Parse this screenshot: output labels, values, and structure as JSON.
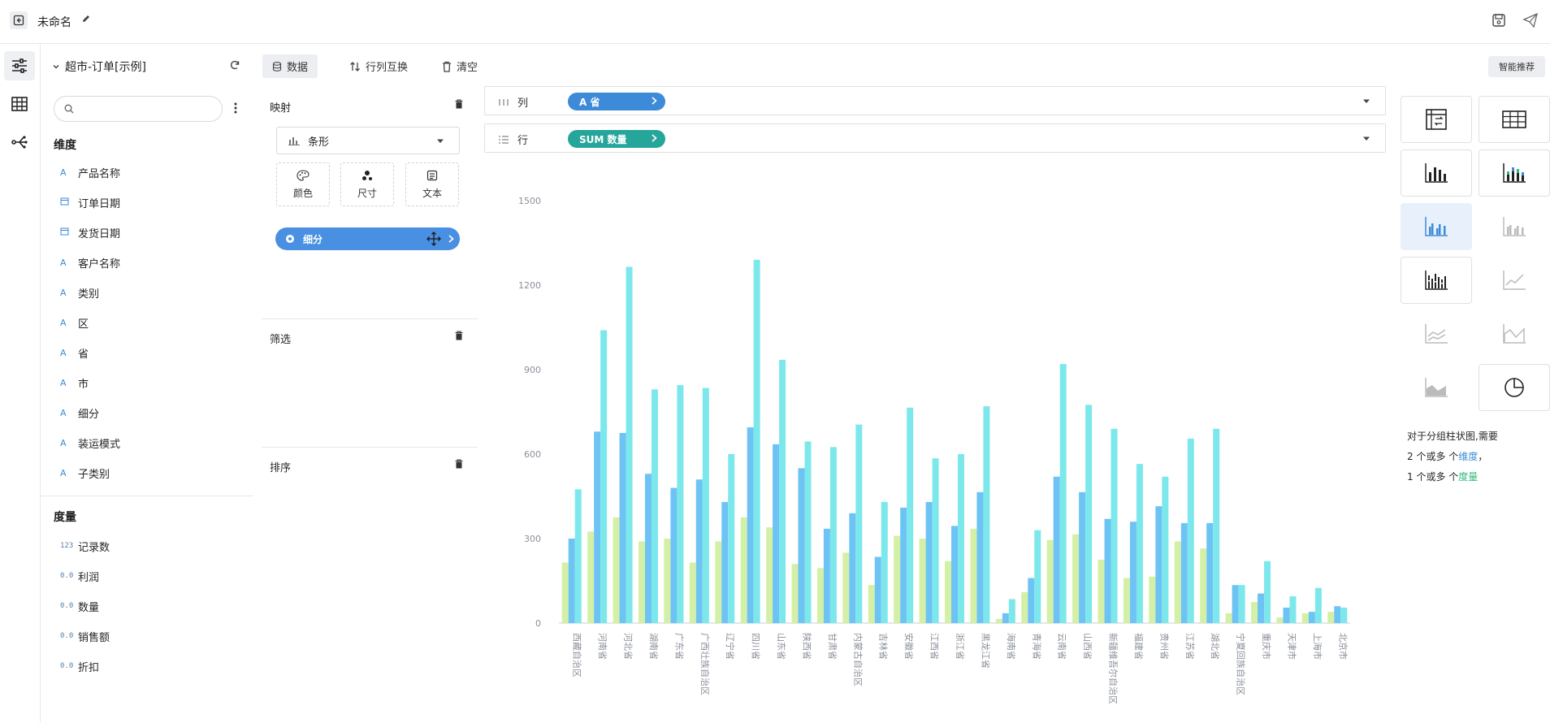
{
  "header": {
    "title": "未命名"
  },
  "dataset": {
    "name": "超市-订单[示例]"
  },
  "search": {
    "placeholder": ""
  },
  "fields": {
    "dimension_header": "维度",
    "dimensions": [
      {
        "type": "date-icon",
        "label": "产品名称",
        "t": "A"
      },
      {
        "type": "calendar-icon",
        "label": "订单日期",
        "t": "cal"
      },
      {
        "type": "calendar-icon",
        "label": "发货日期",
        "t": "cal"
      },
      {
        "type": "text",
        "label": "客户名称",
        "t": "A"
      },
      {
        "type": "text",
        "label": "类别",
        "t": "A"
      },
      {
        "type": "text",
        "label": "区",
        "t": "A"
      },
      {
        "type": "text",
        "label": "省",
        "t": "A"
      },
      {
        "type": "text",
        "label": "市",
        "t": "A"
      },
      {
        "type": "text",
        "label": "细分",
        "t": "A"
      },
      {
        "type": "text",
        "label": "装运模式",
        "t": "A"
      },
      {
        "type": "text",
        "label": "子类别",
        "t": "A"
      }
    ],
    "measure_header": "度量",
    "measures": [
      {
        "label": "记录数",
        "t": "123"
      },
      {
        "label": "利润",
        "t": "0.0"
      },
      {
        "label": "数量",
        "t": "0.0"
      },
      {
        "label": "销售额",
        "t": "0.0"
      },
      {
        "label": "折扣",
        "t": "0.0"
      }
    ]
  },
  "toolbar": {
    "data_label": "数据",
    "swap_label": "行列互换",
    "clear_label": "清空",
    "smart_label": "智能推荐"
  },
  "marks": {
    "mapping_label": "映射",
    "mark_type": "条形",
    "color_label": "颜色",
    "size_label": "尺寸",
    "text_label": "文本",
    "detail_pill": "细分",
    "filter_label": "筛选",
    "sort_label": "排序"
  },
  "shelves": {
    "columns_label": "列",
    "columns_pill": "A 省",
    "rows_label": "行",
    "rows_pill": "SUM  数量"
  },
  "colors": {
    "series1": "#d4f0a6",
    "series2": "#6ec3f5",
    "series3": "#7de8ec",
    "accent": "#4a90e2",
    "teal": "#26a69a"
  },
  "hint": {
    "line1": "对于分组柱状图,需要",
    "line2_prefix": "2 个或多 个",
    "line2_highlight": "维度",
    "line2_suffix": "，",
    "line3_prefix": "1 个或多 个",
    "line3_highlight": "度量"
  },
  "chart_data": {
    "type": "bar",
    "ylim": [
      0,
      1500
    ],
    "yticks": [
      0,
      300,
      600,
      900,
      1200,
      1500
    ],
    "categories": [
      "西藏自治区",
      "河南省",
      "河北省",
      "湖南省",
      "广东省",
      "广西壮族自治区",
      "辽宁省",
      "四川省",
      "山东省",
      "陕西省",
      "甘肃省",
      "内蒙古自治区",
      "吉林省",
      "安徽省",
      "江西省",
      "浙江省",
      "黑龙江省",
      "海南省",
      "青海省",
      "云南省",
      "山西省",
      "新疆维吾尔自治区",
      "福建省",
      "贵州省",
      "江苏省",
      "湖北省",
      "宁夏回族自治区",
      "重庆市",
      "天津市",
      "上海市",
      "北京市"
    ],
    "series": [
      {
        "values": [
          215,
          325,
          375,
          290,
          300,
          215,
          290,
          375,
          340,
          210,
          195,
          250,
          135,
          310,
          300,
          220,
          335,
          15,
          110,
          295,
          315,
          225,
          160,
          165,
          290,
          265,
          35,
          75,
          20,
          35,
          40
        ]
      },
      {
        "values": [
          300,
          680,
          675,
          530,
          480,
          510,
          430,
          695,
          635,
          550,
          335,
          390,
          235,
          410,
          430,
          345,
          465,
          35,
          160,
          520,
          465,
          370,
          360,
          415,
          355,
          355,
          135,
          105,
          55,
          40,
          60
        ]
      },
      {
        "values": [
          475,
          1040,
          1265,
          830,
          845,
          835,
          600,
          1290,
          935,
          645,
          625,
          705,
          430,
          765,
          585,
          600,
          770,
          85,
          330,
          920,
          775,
          690,
          565,
          520,
          655,
          690,
          135,
          220,
          95,
          125,
          55
        ]
      }
    ]
  }
}
